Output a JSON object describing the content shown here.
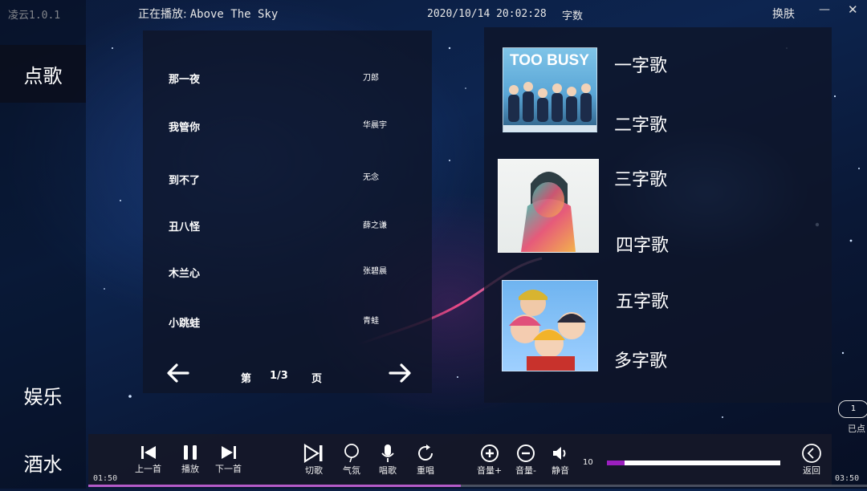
{
  "app": {
    "version": "凌云1.0.1"
  },
  "header": {
    "now_playing_label": "正在播放:",
    "song": "Above The Sky",
    "datetime": "2020/10/14 20:02:28",
    "charset": "字数",
    "skin": "换肤",
    "minimize": "—",
    "close": "✕"
  },
  "sidebar": {
    "items": [
      {
        "label": "点歌"
      },
      {
        "label": "娱乐"
      },
      {
        "label": "酒水"
      }
    ]
  },
  "songs": [
    {
      "title": "那一夜",
      "artist": "刀郎"
    },
    {
      "title": "我管你",
      "artist": "华晨宇"
    },
    {
      "title": "到不了",
      "artist": "无念"
    },
    {
      "title": "丑八怪",
      "artist": "薛之谦"
    },
    {
      "title": "木兰心",
      "artist": "张碧晨"
    },
    {
      "title": "小跳蛙",
      "artist": "青蛙"
    }
  ],
  "pager": {
    "prefix": "第",
    "current": "1/3",
    "suffix": "页"
  },
  "categories": [
    {
      "label": "一字歌"
    },
    {
      "label": "二字歌"
    },
    {
      "label": "三字歌"
    },
    {
      "label": "四字歌"
    },
    {
      "label": "五字歌"
    },
    {
      "label": "多字歌"
    }
  ],
  "covers": [
    {
      "text": "TOO BUSY"
    }
  ],
  "queue": {
    "count": "1",
    "label": "已点"
  },
  "controls": {
    "prev": "上一首",
    "play": "播放",
    "next": "下一首",
    "switch": "切歌",
    "atmosphere": "气氛",
    "sing": "唱歌",
    "replay": "重唱",
    "vol_up": "音量+",
    "vol_down": "音量-",
    "mute": "静音",
    "back": "返回"
  },
  "volume": {
    "value": "10",
    "level": 0.1
  },
  "playback": {
    "elapsed": "01:50",
    "total": "03:50",
    "progress": 0.478
  },
  "colors": {
    "accent": "#9b1fbf",
    "panel": "#0e1428"
  }
}
